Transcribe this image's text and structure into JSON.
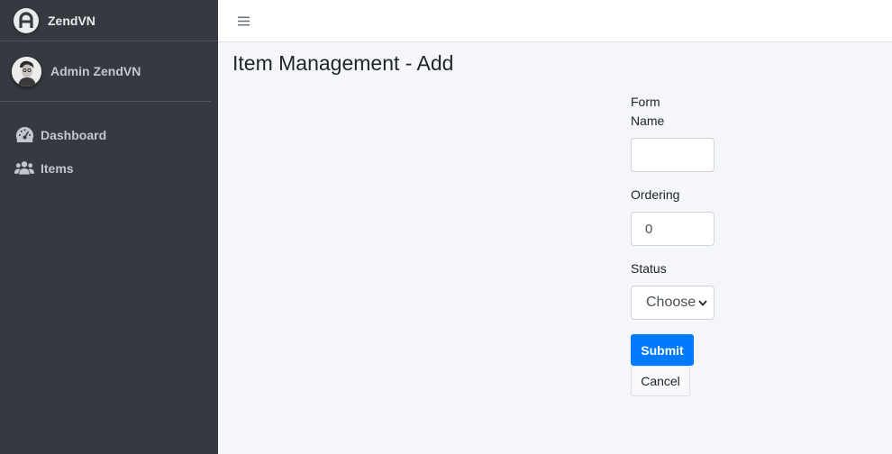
{
  "brand": {
    "name": "ZendVN",
    "logo_icon": "logo-icon"
  },
  "user": {
    "name": "Admin ZendVN",
    "avatar_icon": "avatar-icon"
  },
  "sidebar": {
    "items": [
      {
        "label": "Dashboard",
        "icon": "tachometer-icon"
      },
      {
        "label": "Items",
        "icon": "users-icon"
      }
    ]
  },
  "topbar": {
    "menu_icon": "hamburger-icon"
  },
  "page": {
    "title": "Item Management - Add"
  },
  "form": {
    "title": "Form",
    "name_label": "Name",
    "name_value": "",
    "ordering_label": "Ordering",
    "ordering_value": "0",
    "status_label": "Status",
    "status_selected": "Choose",
    "submit_label": "Submit",
    "cancel_label": "Cancel"
  },
  "colors": {
    "sidebar_bg": "#343a40",
    "content_bg": "#f4f6f9",
    "primary": "#007bff"
  }
}
